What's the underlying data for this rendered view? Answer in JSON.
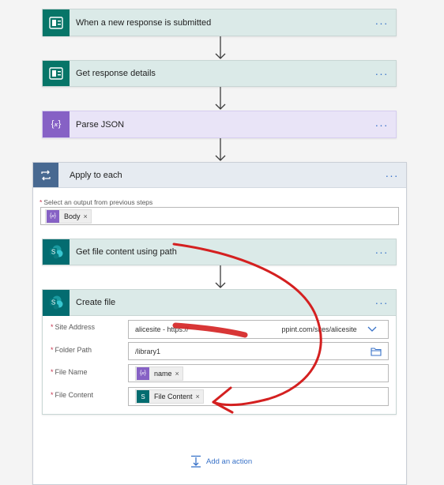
{
  "colors": {
    "forms_green": "#077568",
    "parse_purple": "#8661c5",
    "sharepoint_teal": "#036c70",
    "apply_gray": "#486991",
    "link_blue": "#3872c8",
    "annotation_red": "#d42020"
  },
  "steps": {
    "trigger": {
      "title": "When a new response is submitted",
      "icon": "forms-icon"
    },
    "get_response": {
      "title": "Get response details",
      "icon": "forms-icon"
    },
    "parse_json": {
      "title": "Parse JSON",
      "icon": "braces-icon",
      "icon_text": "{𝓍}"
    },
    "apply_each": {
      "title": "Apply to each",
      "icon": "loop-icon",
      "select_label": "Select an output from previous steps",
      "token_label": "Body"
    },
    "get_file": {
      "title": "Get file content using path",
      "icon": "sharepoint-icon"
    },
    "create_file": {
      "title": "Create file",
      "icon": "sharepoint-icon",
      "fields": {
        "site_address_label": "Site Address",
        "site_address_value": "alicesite - https://",
        "site_address_value_tail": "ppint.com/sites/alicesite",
        "folder_path_label": "Folder Path",
        "folder_path_value": "/library1",
        "file_name_label": "File Name",
        "file_name_token": "name",
        "file_content_label": "File Content",
        "file_content_token": "File Content"
      }
    }
  },
  "more_glyph": "···",
  "required_mark": "*",
  "close_glyph": "×",
  "add_action": "Add an action"
}
